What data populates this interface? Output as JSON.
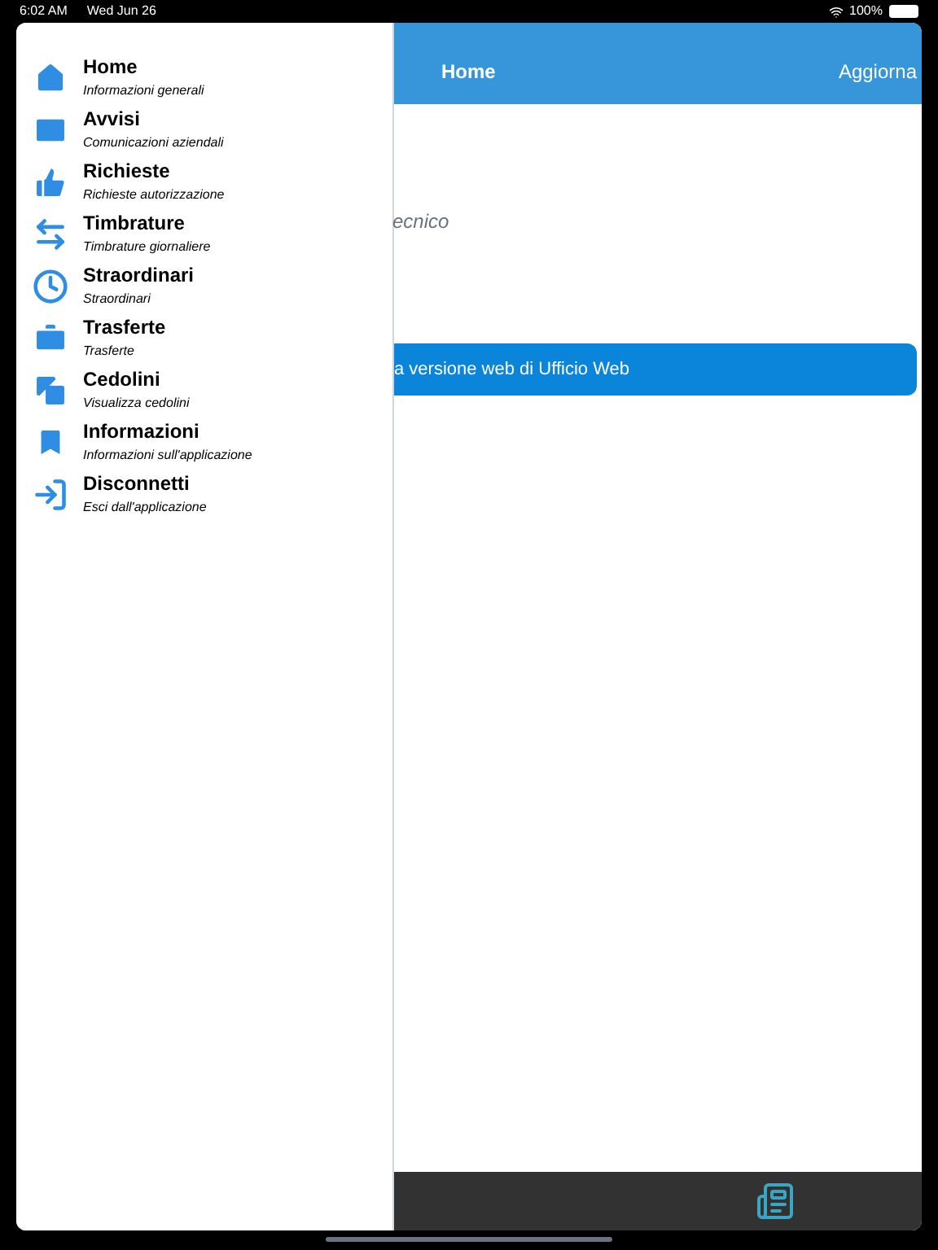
{
  "status_bar": {
    "time": "6:02 AM",
    "date": "Wed Jun 26",
    "battery": "100%"
  },
  "header": {
    "title": "Home",
    "action": "Aggiorna"
  },
  "content": {
    "subtitle": "ecnico",
    "web_button": "a versione web di Ufficio Web"
  },
  "drawer": {
    "items": [
      {
        "title": "Home",
        "subtitle": "Informazioni generali"
      },
      {
        "title": "Avvisi",
        "subtitle": "Comunicazioni aziendali"
      },
      {
        "title": "Richieste",
        "subtitle": "Richieste autorizzazione"
      },
      {
        "title": "Timbrature",
        "subtitle": "Timbrature giornaliere"
      },
      {
        "title": "Straordinari",
        "subtitle": "Straordinari"
      },
      {
        "title": "Trasferte",
        "subtitle": "Trasferte"
      },
      {
        "title": "Cedolini",
        "subtitle": "Visualizza cedolini"
      },
      {
        "title": "Informazioni",
        "subtitle": "Informazioni sull'applicazione"
      },
      {
        "title": "Disconnetti",
        "subtitle": "Esci dall'applicazione"
      }
    ]
  }
}
